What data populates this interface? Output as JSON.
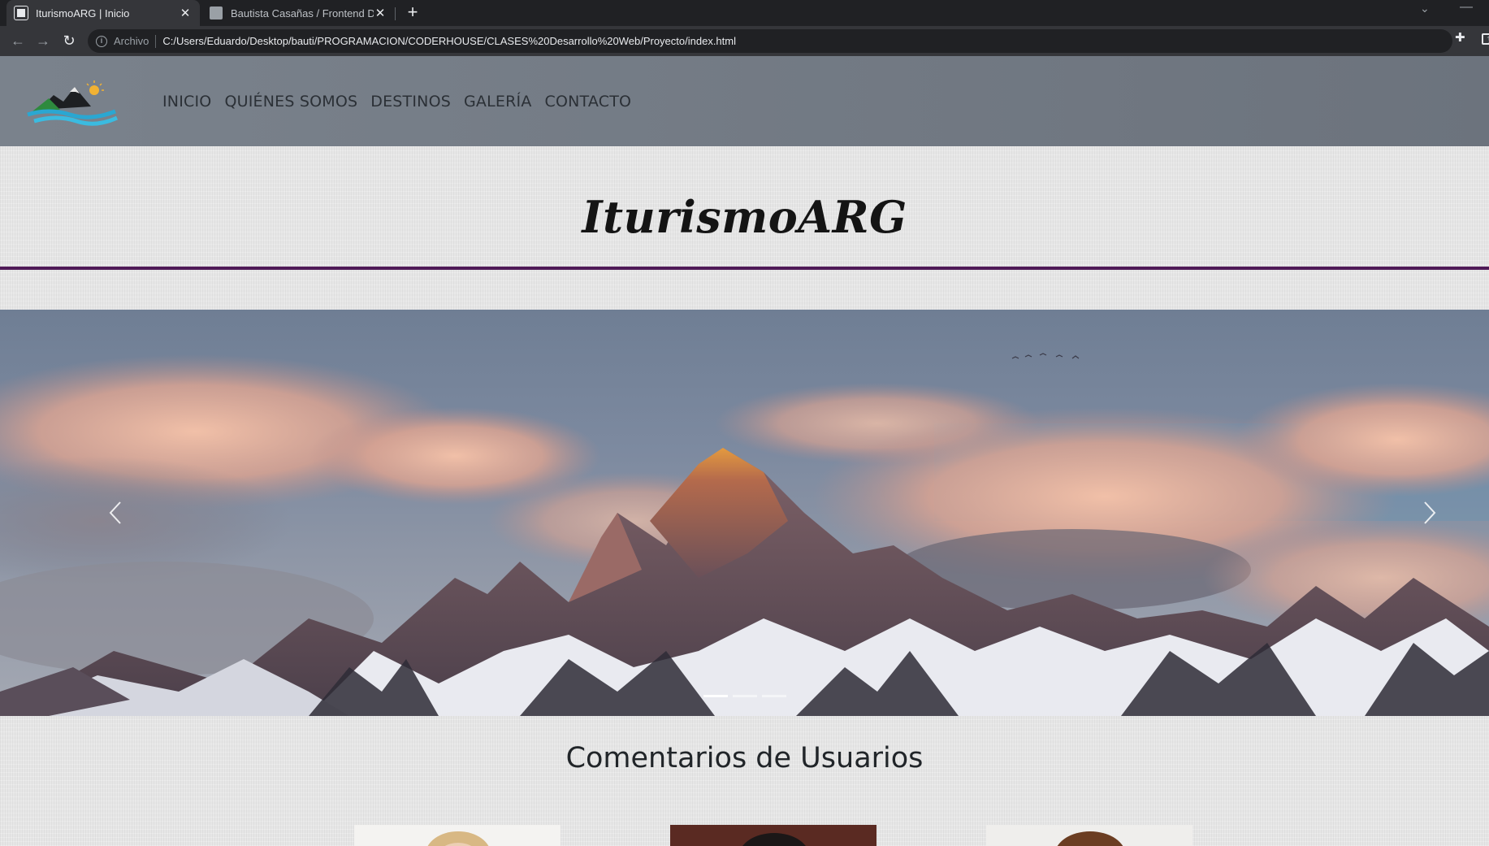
{
  "browser": {
    "tabs": [
      {
        "title": "IturismoARG | Inicio",
        "active": true
      },
      {
        "title": "Bautista Casañas / Frontend Deve",
        "active": false
      }
    ],
    "archivo_label": "Archivo",
    "url": "C:/Users/Eduardo/Desktop/bauti/PROGRAMACION/CODERHOUSE/CLASES%20Desarrollo%20Web/Proyecto/index.html"
  },
  "nav": {
    "items": [
      "INICIO",
      "QUIÉNES SOMOS",
      "DESTINOS",
      "GALERÍA",
      "CONTACTO"
    ]
  },
  "hero": {
    "title": "IturismoARG"
  },
  "carousel": {
    "indicators": 3,
    "active_index": 0
  },
  "comments": {
    "title": "Comentarios de Usuarios"
  },
  "colors": {
    "header_bg": "#6c737d",
    "rule": "#4f1a57",
    "page_bg": "#e6e6e6"
  }
}
